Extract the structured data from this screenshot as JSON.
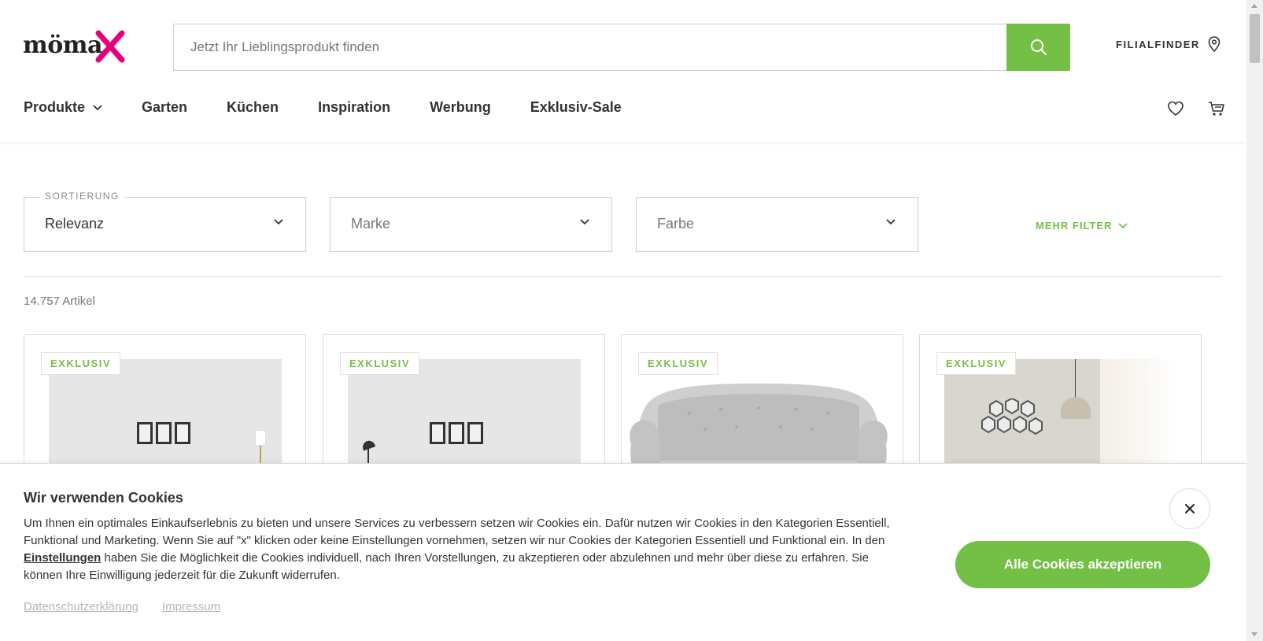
{
  "brand": {
    "logo_text": "möma",
    "accent": "#e6007e",
    "green": "#74c047"
  },
  "search": {
    "placeholder": "Jetzt Ihr Lieblingsprodukt finden",
    "value": ""
  },
  "header": {
    "filialfinder_label": "FILIALFINDER"
  },
  "nav": {
    "items": [
      "Produkte",
      "Garten",
      "Küchen",
      "Inspiration",
      "Werbung",
      "Exklusiv-Sale"
    ]
  },
  "filters": {
    "sort": {
      "legend": "SORTIERUNG",
      "value": "Relevanz"
    },
    "brand": {
      "placeholder": "Marke"
    },
    "color": {
      "placeholder": "Farbe"
    },
    "more_label": "MEHR FILTER"
  },
  "results": {
    "count_text": "14.757 Artikel"
  },
  "products": [
    {
      "badge": "EXKLUSIV"
    },
    {
      "badge": "EXKLUSIV"
    },
    {
      "badge": "EXKLUSIV"
    },
    {
      "badge": "EXKLUSIV"
    }
  ],
  "cookie": {
    "title": "Wir verwenden Cookies",
    "text_before": "Um Ihnen ein optimales Einkaufserlebnis zu bieten und unsere Services zu verbessern setzen wir Cookies ein. Dafür nutzen wir Cookies in den Kategorien Essentiell, Funktional und Marketing. Wenn Sie auf \"x\" klicken oder keine Einstellungen vornehmen, setzen wir nur Cookies der Kategorien Essentiell und Funktional ein. In den ",
    "settings_link": "Einstellungen",
    "text_after": " haben Sie die Möglichkeit die Cookies individuell, nach Ihren Vorstellungen, zu akzeptieren oder abzulehnen und mehr über diese zu erfahren. Sie können Ihre Einwilligung jederzeit für die Zukunft widerrufen.",
    "privacy_link": "Datenschutzerklärung",
    "imprint_link": "Impressum",
    "accept_label": "Alle Cookies akzeptieren",
    "close_label": "×"
  }
}
